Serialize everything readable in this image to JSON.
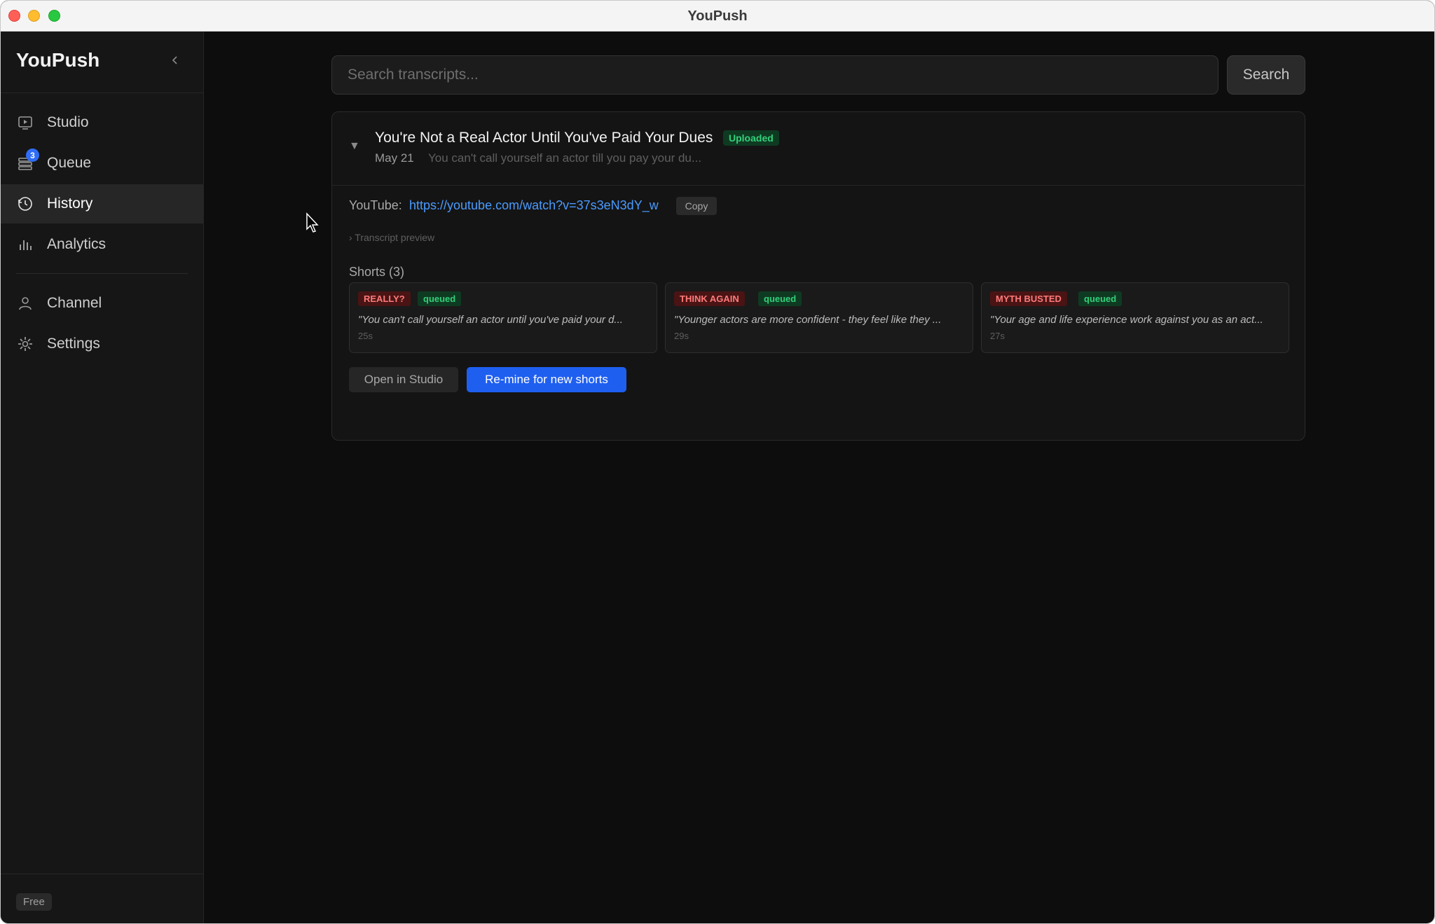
{
  "window": {
    "title": "YouPush"
  },
  "sidebar": {
    "brand": "YouPush",
    "items": [
      {
        "label": "Studio",
        "icon": "play-square-icon"
      },
      {
        "label": "Queue",
        "icon": "queue-stack-icon",
        "badge": "3"
      },
      {
        "label": "History",
        "icon": "history-clock-icon",
        "active": true
      },
      {
        "label": "Analytics",
        "icon": "bar-chart-icon"
      },
      {
        "label": "Channel",
        "icon": "user-icon"
      },
      {
        "label": "Settings",
        "icon": "gear-icon"
      }
    ],
    "plan": "Free"
  },
  "search": {
    "placeholder": "Search transcripts...",
    "value": "",
    "button": "Search"
  },
  "video": {
    "title": "You're Not a Real Actor Until You've Paid Your Dues",
    "status": "Uploaded",
    "date": "May 21",
    "snippet": "You can't call yourself an actor till you pay your du...",
    "youtube_label": "YouTube:",
    "youtube_url": "https://youtube.com/watch?v=37s3eN3dY_w",
    "copy_label": "Copy",
    "transcript_preview": "› Transcript preview",
    "shorts_heading": "Shorts (3)",
    "shorts": [
      {
        "hook": "REALLY?",
        "status": "queued",
        "quote": "\"You can't call yourself an actor until you've paid your d...",
        "duration": "25s"
      },
      {
        "hook": "THINK AGAIN",
        "status": "queued",
        "quote": "\"Younger actors are more confident - they feel like they ...",
        "duration": "29s"
      },
      {
        "hook": "MYTH BUSTED",
        "status": "queued",
        "quote": "\"Your age and life experience work against you as an act...",
        "duration": "27s"
      }
    ],
    "open_studio_label": "Open in Studio",
    "remine_label": "Re-mine for new shorts"
  },
  "colors": {
    "accent": "#1f5ff0",
    "link": "#4a9bff",
    "success": "#34d07a",
    "hook_red": "#ff7a7a",
    "background": "#0d0d0d"
  }
}
